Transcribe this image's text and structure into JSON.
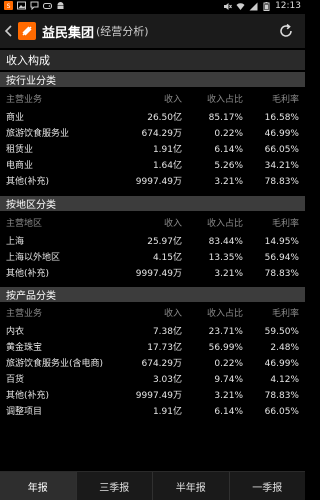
{
  "status_bar": {
    "time": "12:13",
    "left_icons": [
      "app-notification-icon",
      "image-icon",
      "chat-icon",
      "game-icon",
      "android-icon"
    ],
    "right_icons": [
      "mute-icon",
      "wifi-icon",
      "signal-icon",
      "battery-icon"
    ]
  },
  "header": {
    "title": "益民集团",
    "code": "(经营分析)",
    "logo_color": "#ff6a00"
  },
  "section_title": "收入构成",
  "categories": [
    {
      "title": "按行业分类",
      "columns": [
        "主营业务",
        "收入",
        "收入占比",
        "毛利率"
      ],
      "rows": [
        [
          "商业",
          "26.50亿",
          "85.17%",
          "16.58%"
        ],
        [
          "旅游饮食服务业",
          "674.29万",
          "0.22%",
          "46.99%"
        ],
        [
          "租赁业",
          "1.91亿",
          "6.14%",
          "66.05%"
        ],
        [
          "电商业",
          "1.64亿",
          "5.26%",
          "34.21%"
        ],
        [
          "其他(补充)",
          "9997.49万",
          "3.21%",
          "78.83%"
        ]
      ]
    },
    {
      "title": "按地区分类",
      "columns": [
        "主营地区",
        "收入",
        "收入占比",
        "毛利率"
      ],
      "rows": [
        [
          "上海",
          "25.97亿",
          "83.44%",
          "14.95%"
        ],
        [
          "上海以外地区",
          "4.15亿",
          "13.35%",
          "56.94%"
        ],
        [
          "其他(补充)",
          "9997.49万",
          "3.21%",
          "78.83%"
        ]
      ]
    },
    {
      "title": "按产品分类",
      "columns": [
        "主营业务",
        "收入",
        "收入占比",
        "毛利率"
      ],
      "rows": [
        [
          "内衣",
          "7.38亿",
          "23.71%",
          "59.50%"
        ],
        [
          "黄金珠宝",
          "17.73亿",
          "56.99%",
          "2.48%"
        ],
        [
          "旅游饮食服务业(含电商)",
          "674.29万",
          "0.22%",
          "46.99%"
        ],
        [
          "百货",
          "3.03亿",
          "9.74%",
          "4.12%"
        ],
        [
          "其他(补充)",
          "9997.49万",
          "3.21%",
          "78.83%"
        ],
        [
          "调整项目",
          "1.91亿",
          "6.14%",
          "66.05%"
        ]
      ]
    }
  ],
  "tabs": [
    "年报",
    "三季报",
    "半年报",
    "一季报"
  ],
  "active_tab": 0
}
